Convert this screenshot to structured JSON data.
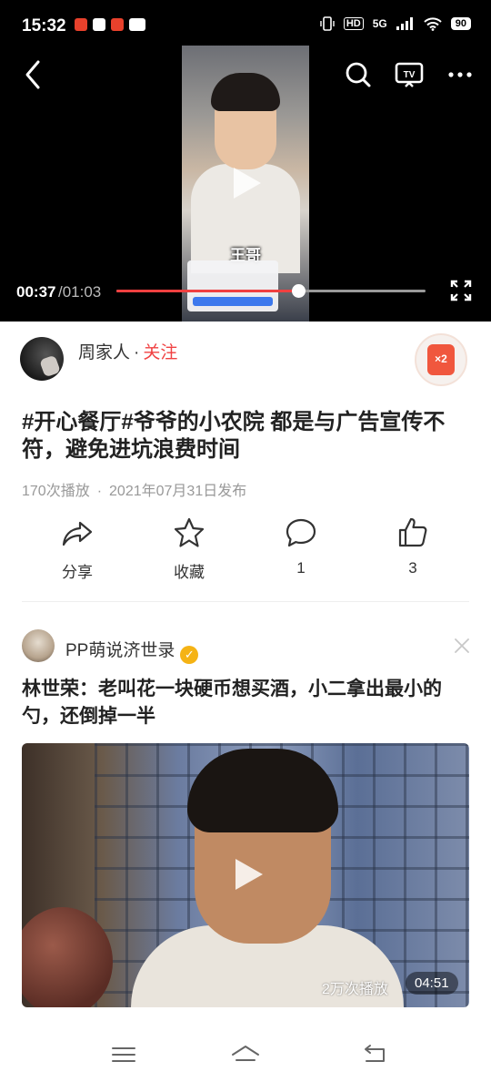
{
  "status_bar": {
    "time": "15:32",
    "network": "5G",
    "hd": "HD",
    "battery": "90"
  },
  "player": {
    "current_time": "00:37",
    "duration": "/01:03",
    "progress": 0.587,
    "thumbnail_caption": "王哥",
    "accent_color": "#f04040"
  },
  "author": {
    "name": "周家人",
    "follow": "关注",
    "redpack_badge": "×2"
  },
  "video": {
    "title": "#开心餐厅#爷爷的小农院 都是与广告宣传不符，避免进坑浪费时间",
    "plays": "170次播放",
    "published": "2021年07月31日发布"
  },
  "actions": {
    "share": "分享",
    "favorite": "收藏",
    "comment_count": "1",
    "like_count": "3"
  },
  "recommended": {
    "author": "PP萌说济世录",
    "verified_icon": "verified-badge-icon",
    "title": "林世荣：老叫花一块硬币想买酒，小二拿出最小的勺，还倒掉一半",
    "plays": "2万次播放",
    "duration": "04:51"
  },
  "icons": {
    "back": "back-arrow-icon",
    "search": "search-icon",
    "tv": "tv-cast-icon",
    "more": "more-dots-icon",
    "fullscreen": "fullscreen-icon",
    "share": "share-icon",
    "favorite": "star-icon",
    "comment": "comment-bubble-icon",
    "like": "thumbs-up-icon",
    "close": "close-icon"
  }
}
